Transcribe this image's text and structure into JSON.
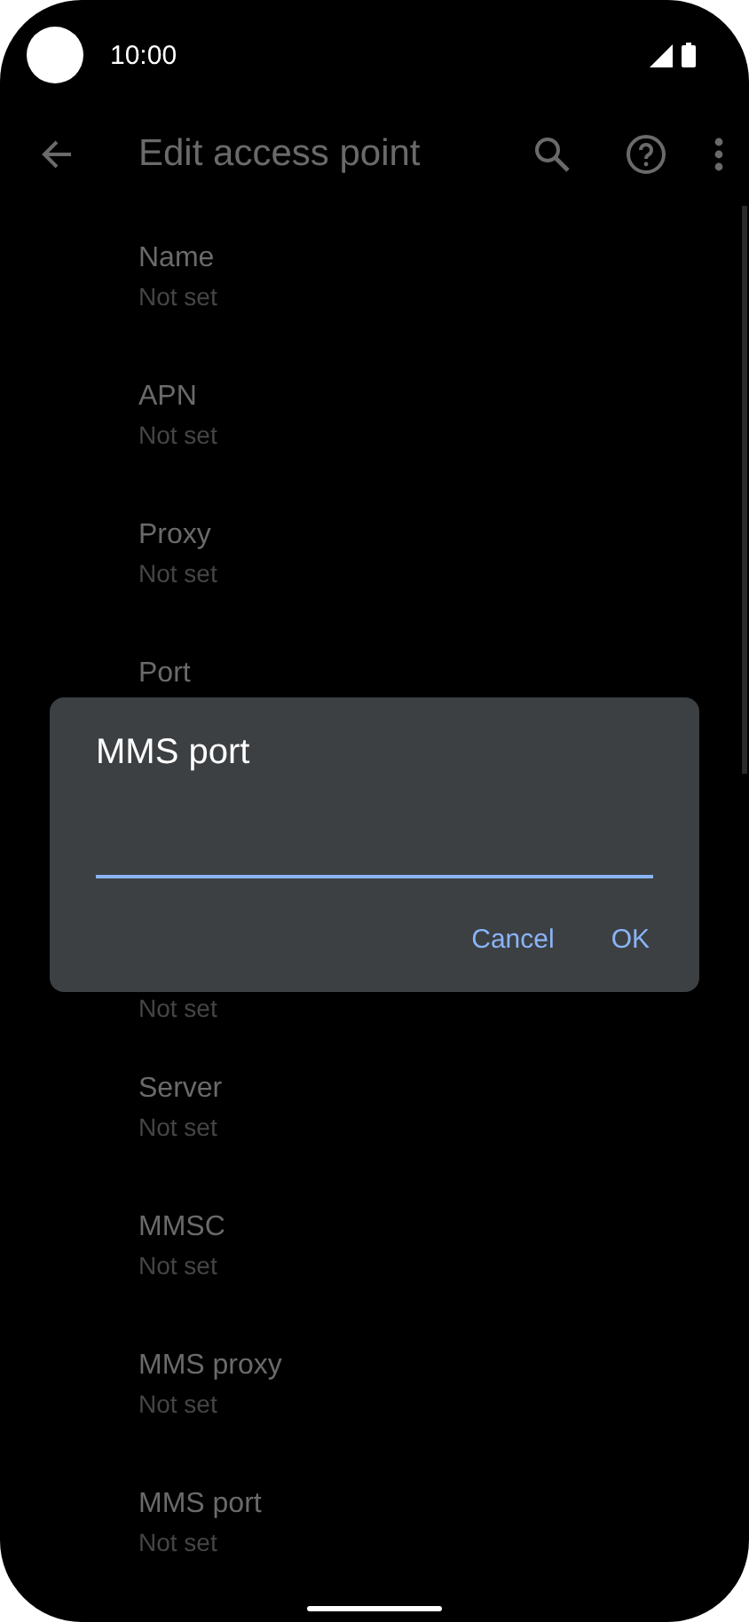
{
  "status_bar": {
    "time": "10:00"
  },
  "app_bar": {
    "title": "Edit access point"
  },
  "list": {
    "items": [
      {
        "kind": "row",
        "title": "Name",
        "subtitle": "Not set"
      },
      {
        "kind": "row",
        "title": "APN",
        "subtitle": "Not set"
      },
      {
        "kind": "row",
        "title": "Proxy",
        "subtitle": "Not set"
      },
      {
        "kind": "title_only",
        "title": "Port"
      },
      {
        "kind": "subtitle_only",
        "subtitle": "Not set"
      },
      {
        "kind": "row",
        "title": "Server",
        "subtitle": "Not set"
      },
      {
        "kind": "row",
        "title": "MMSC",
        "subtitle": "Not set"
      },
      {
        "kind": "row",
        "title": "MMS proxy",
        "subtitle": "Not set"
      },
      {
        "kind": "row",
        "title": "MMS port",
        "subtitle": "Not set"
      }
    ]
  },
  "dialog": {
    "title": "MMS port",
    "field": {
      "focused": true
    },
    "buttons": [
      "Cancel",
      "OK"
    ]
  }
}
